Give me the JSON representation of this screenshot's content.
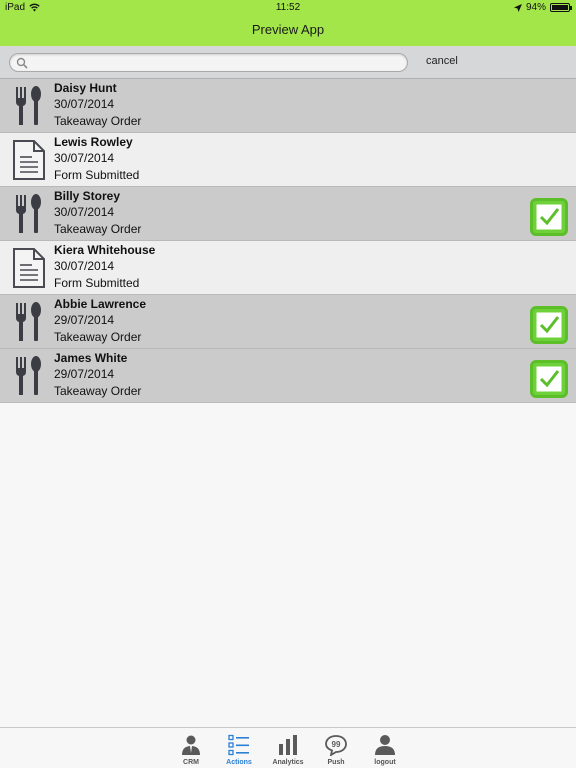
{
  "status": {
    "device": "iPad",
    "time": "11:52",
    "battery": "94%"
  },
  "nav": {
    "title": "Preview App"
  },
  "search": {
    "placeholder": "",
    "cancel_label": "cancel"
  },
  "items": [
    {
      "name": "Daisy Hunt",
      "date": "30/07/2014",
      "type": "Takeaway Order",
      "icon": "cutlery-icon",
      "checked": false
    },
    {
      "name": "Lewis Rowley",
      "date": "30/07/2014",
      "type": "Form Submitted",
      "icon": "document-icon",
      "checked": false
    },
    {
      "name": "Billy Storey",
      "date": "30/07/2014",
      "type": "Takeaway Order",
      "icon": "cutlery-icon",
      "checked": true
    },
    {
      "name": "Kiera Whitehouse",
      "date": "30/07/2014",
      "type": "Form Submitted",
      "icon": "document-icon",
      "checked": false
    },
    {
      "name": "Abbie Lawrence",
      "date": "29/07/2014",
      "type": "Takeaway Order",
      "icon": "cutlery-icon",
      "checked": true
    },
    {
      "name": "James White",
      "date": "29/07/2014",
      "type": "Takeaway Order",
      "icon": "cutlery-icon",
      "checked": true
    }
  ],
  "tabs": [
    {
      "label": "CRM",
      "icon": "person-suit-icon",
      "active": false
    },
    {
      "label": "Actions",
      "icon": "list-icon",
      "active": true
    },
    {
      "label": "Analytics",
      "icon": "bar-chart-icon",
      "active": false
    },
    {
      "label": "Push",
      "icon": "speech-bubble-icon",
      "active": false
    },
    {
      "label": "logout",
      "icon": "person-icon",
      "active": false
    }
  ],
  "colors": {
    "bar_green": "#a3e64a",
    "check_green": "#6fd13a",
    "active_tab": "#2b7fd4"
  }
}
